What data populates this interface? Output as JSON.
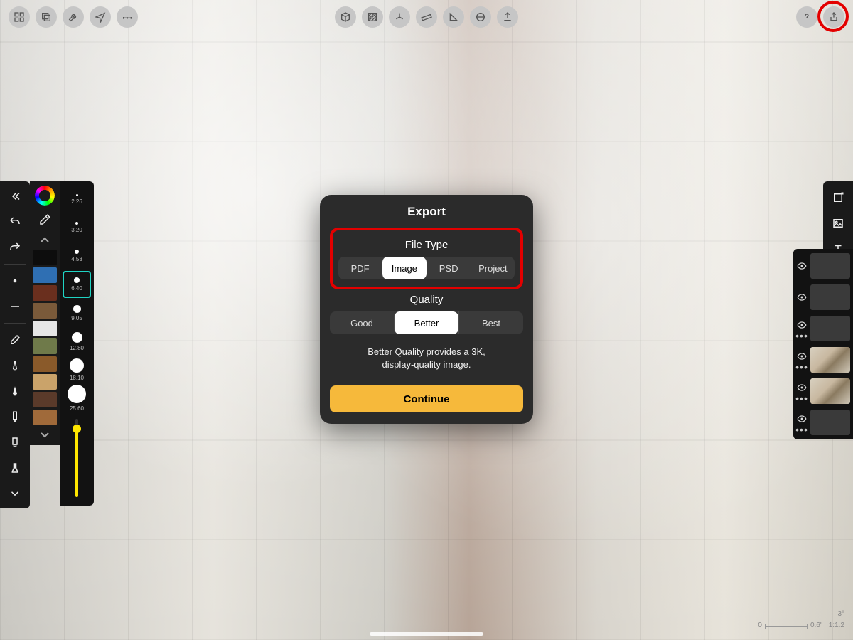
{
  "topbar": {
    "left": [
      "grid",
      "layers-stack",
      "wrench",
      "navigate",
      "ruler-h"
    ],
    "center": [
      "cube",
      "hatch",
      "axis",
      "measure",
      "angle",
      "level",
      "upload"
    ],
    "right": [
      "help",
      "share"
    ]
  },
  "left_tools": {
    "collapse": "«",
    "items": [
      "undo",
      "redo",
      "point",
      "line",
      "eraser",
      "pen-fine",
      "pen-bold",
      "marker",
      "highlighter",
      "brush",
      "chevron-down"
    ]
  },
  "palette": {
    "top": [
      "color-ring",
      "eyedropper",
      "caret-up"
    ],
    "swatches": [
      "#0d0d0d",
      "#2f6fb3",
      "#6a2f1e",
      "#7a5a3a",
      "#e6e6e6",
      "#6f7a4a",
      "#8a5a2a",
      "#caa36a",
      "#5a3a2a",
      "#a06a3a"
    ],
    "caret_down": "caret-down"
  },
  "brush_sizes": [
    {
      "label": "2.26",
      "d": 3
    },
    {
      "label": "3.20",
      "d": 4
    },
    {
      "label": "4.53",
      "d": 6
    },
    {
      "label": "6.40",
      "d": 8,
      "selected": true
    },
    {
      "label": "9.05",
      "d": 11
    },
    {
      "label": "12.80",
      "d": 15
    },
    {
      "label": "18.10",
      "d": 20
    },
    {
      "label": "25.60",
      "d": 26
    }
  ],
  "right_tools": [
    "layer-add",
    "image",
    "text"
  ],
  "layers": [
    {
      "eye": true,
      "dots": false,
      "thumb": "blank"
    },
    {
      "eye": true,
      "dots": false,
      "thumb": "blank"
    },
    {
      "eye": true,
      "dots": true,
      "thumb": "blank"
    },
    {
      "eye": true,
      "dots": true,
      "thumb": "img"
    },
    {
      "eye": true,
      "dots": true,
      "thumb": "img"
    },
    {
      "eye": true,
      "dots": true,
      "thumb": "blank"
    }
  ],
  "status": {
    "angle": "3°",
    "ruler_l": "0",
    "ruler_r": "0.6\"",
    "zoom": "1:1.2"
  },
  "modal": {
    "title": "Export",
    "filetype": {
      "label": "File Type",
      "options": [
        "PDF",
        "Image",
        "PSD",
        "Project"
      ],
      "selected": "Image"
    },
    "quality": {
      "label": "Quality",
      "options": [
        "Good",
        "Better",
        "Best"
      ],
      "selected": "Better"
    },
    "desc_l1": "Better Quality provides a 3K,",
    "desc_l2": "display-quality image.",
    "continue": "Continue"
  }
}
